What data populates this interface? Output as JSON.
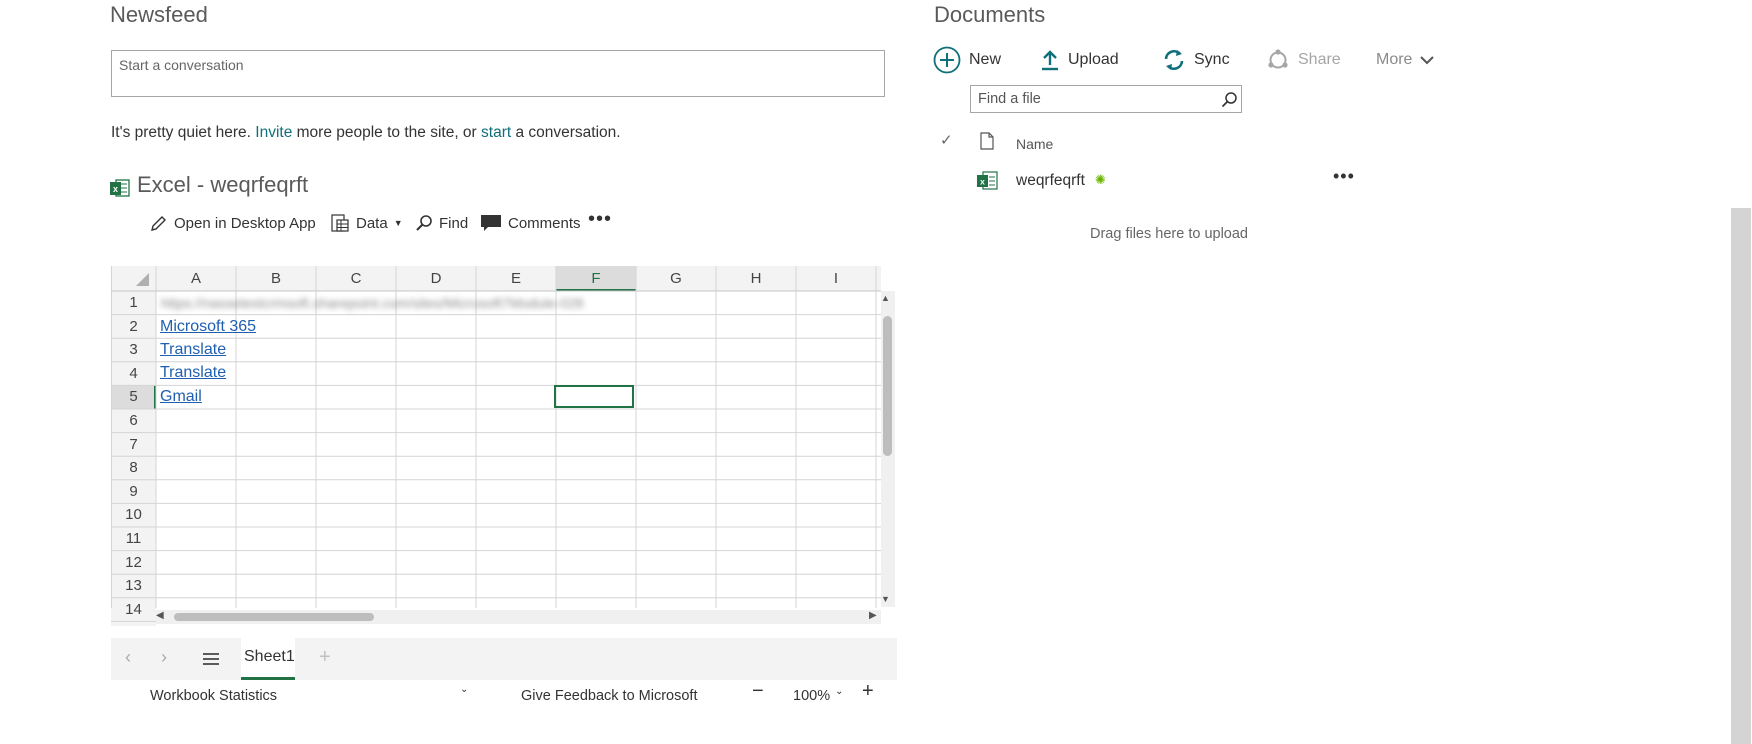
{
  "newsfeed": {
    "title": "Newsfeed",
    "conversation_placeholder": "Start a conversation",
    "quiet_prefix": "It's pretty quiet here. ",
    "invite_link": "Invite",
    "quiet_middle": " more people to the site, or ",
    "start_link": "start",
    "quiet_suffix": " a conversation."
  },
  "excel": {
    "title": "Excel - weqrfeqrft",
    "toolbar": {
      "open_desktop": "Open in Desktop App",
      "data": "Data",
      "find": "Find",
      "comments": "Comments"
    },
    "columns": [
      "A",
      "B",
      "C",
      "D",
      "E",
      "F",
      "G",
      "H",
      "I"
    ],
    "rows": [
      "1",
      "2",
      "3",
      "4",
      "5",
      "6",
      "7",
      "8",
      "9",
      "10",
      "11",
      "12",
      "13",
      "14"
    ],
    "selected_cell": "F5",
    "cells": {
      "A1": "https://nassetestcrmsoft.sharepoint.com/sites/Microsoft7Module-028",
      "A2": "Microsoft 365",
      "A3": "Translate",
      "A4": "Translate",
      "A5": "Gmail"
    },
    "sheet_tab": "Sheet1",
    "status": {
      "workbook_statistics": "Workbook Statistics",
      "feedback": "Give Feedback to Microsoft",
      "zoom": "100%"
    }
  },
  "documents": {
    "title": "Documents",
    "commands": {
      "new": "New",
      "upload": "Upload",
      "sync": "Sync",
      "share": "Share",
      "more": "More"
    },
    "find_placeholder": "Find a file",
    "column_name": "Name",
    "files": [
      {
        "name": "weqrfeqrft",
        "icon": "excel-file-icon"
      }
    ],
    "drag_hint": "Drag files here to upload"
  },
  "colors": {
    "accent": "#0f6f7a",
    "excel_green": "#217346",
    "link_blue": "#1f5fb0",
    "new_badge": "#6bb700"
  }
}
